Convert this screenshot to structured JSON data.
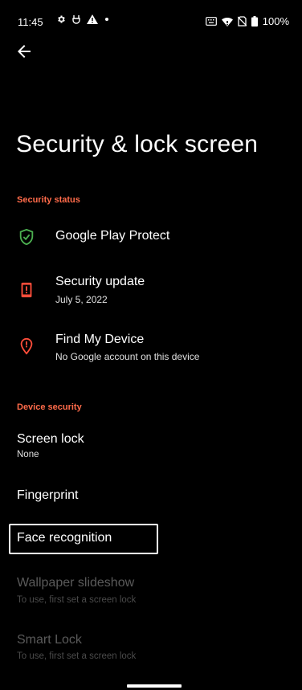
{
  "status_bar": {
    "time": "11:45",
    "battery": "100%",
    "left_icons": [
      "settings-gear-icon",
      "usb-icon",
      "warning-icon",
      "dot-icon"
    ],
    "right_icons": [
      "keyboard-icon",
      "wifi-icon",
      "no-sim-icon",
      "battery-icon"
    ]
  },
  "header": {
    "title": "Security & lock screen"
  },
  "security_status": {
    "header": "Security status",
    "items": [
      {
        "title": "Google Play Protect",
        "subtitle": "",
        "icon": "shield-check-icon"
      },
      {
        "title": "Security update",
        "subtitle": "July 5, 2022",
        "icon": "phone-alert-icon"
      },
      {
        "title": "Find My Device",
        "subtitle": "No Google account on this device",
        "icon": "location-alert-icon"
      }
    ]
  },
  "device_security": {
    "header": "Device security",
    "items": [
      {
        "title": "Screen lock",
        "subtitle": "None",
        "enabled": true
      },
      {
        "title": "Fingerprint",
        "subtitle": "",
        "enabled": true
      },
      {
        "title": "Face recognition",
        "subtitle": "",
        "enabled": true
      },
      {
        "title": "Wallpaper slideshow",
        "subtitle": "To use, first set a screen lock",
        "enabled": false
      },
      {
        "title": "Smart Lock",
        "subtitle": "To use, first set a screen lock",
        "enabled": false
      }
    ]
  },
  "colors": {
    "accent_orange": "#ff6b4a",
    "protect_green": "#4caf50",
    "alert_red": "#ff4d3a",
    "disabled_text": "#5a5a5a"
  }
}
